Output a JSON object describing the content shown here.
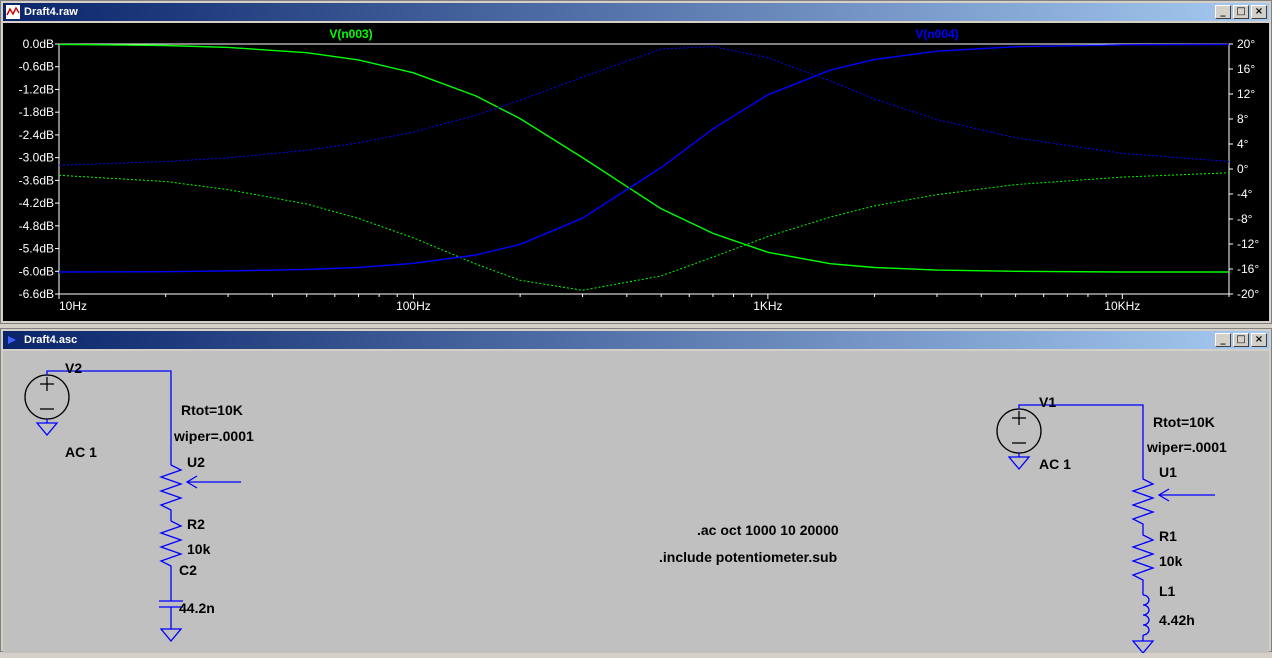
{
  "plot_window": {
    "title": "Draft4.raw",
    "buttons": [
      "_",
      "□",
      "×"
    ]
  },
  "schematic_window": {
    "title": "Draft4.asc",
    "buttons": [
      "_",
      "□",
      "×"
    ]
  },
  "colors": {
    "plot_background": "#000000",
    "trace_green": "#00ff00",
    "trace_blue": "#0000ff",
    "axis_text": "#ffffff",
    "schematic_wire": "#0000ff",
    "schematic_background": "#c0c0c0"
  },
  "chart_data": {
    "type": "line",
    "xscale": "log",
    "xlim": [
      10,
      20000
    ],
    "x_ticks": [
      {
        "value": 10,
        "label": "10Hz"
      },
      {
        "value": 100,
        "label": "100Hz"
      },
      {
        "value": 1000,
        "label": "1KHz"
      },
      {
        "value": 10000,
        "label": "10KHz"
      }
    ],
    "ylim_left": [
      -6.6,
      0
    ],
    "y_ticks_left": [
      "0.0dB",
      "-0.6dB",
      "-1.2dB",
      "-1.8dB",
      "-2.4dB",
      "-3.0dB",
      "-3.6dB",
      "-4.2dB",
      "-4.8dB",
      "-5.4dB",
      "-6.0dB",
      "-6.6dB"
    ],
    "ylim_right": [
      -20,
      20
    ],
    "y_ticks_right": [
      "20°",
      "16°",
      "12°",
      "8°",
      "4°",
      "0°",
      "-4°",
      "-8°",
      "-12°",
      "-16°",
      "-20°"
    ],
    "series": [
      {
        "name": "V(n003)",
        "color": "#00ff00",
        "magnitude": {
          "x": [
            10,
            20,
            30,
            50,
            70,
            100,
            150,
            200,
            300,
            500,
            700,
            1000,
            1500,
            2000,
            3000,
            5000,
            10000,
            20000
          ],
          "y": [
            -0.01,
            -0.04,
            -0.09,
            -0.23,
            -0.42,
            -0.76,
            -1.37,
            -1.97,
            -3.0,
            -4.35,
            -5.0,
            -5.5,
            -5.8,
            -5.9,
            -5.97,
            -6.0,
            -6.02,
            -6.02
          ]
        },
        "phase": {
          "x": [
            10,
            20,
            30,
            50,
            70,
            100,
            150,
            200,
            300,
            500,
            700,
            1000,
            1500,
            2000,
            3000,
            5000,
            10000,
            20000
          ],
          "y": [
            -1.0,
            -2.0,
            -3.3,
            -5.6,
            -7.9,
            -11.0,
            -15.2,
            -17.8,
            -19.4,
            -17.1,
            -14.1,
            -10.8,
            -7.7,
            -5.9,
            -4.1,
            -2.5,
            -1.3,
            -0.6
          ]
        }
      },
      {
        "name": "V(n004)",
        "color": "#0000ff",
        "magnitude": {
          "x": [
            10,
            20,
            30,
            50,
            70,
            100,
            150,
            200,
            300,
            500,
            700,
            1000,
            1500,
            2000,
            3000,
            5000,
            10000,
            20000
          ],
          "y": [
            -6.02,
            -6.01,
            -5.99,
            -5.95,
            -5.9,
            -5.79,
            -5.57,
            -5.29,
            -4.6,
            -3.26,
            -2.24,
            -1.34,
            -0.69,
            -0.41,
            -0.19,
            -0.07,
            -0.02,
            -0.01
          ]
        },
        "phase": {
          "x": [
            10,
            20,
            30,
            50,
            70,
            100,
            150,
            200,
            300,
            500,
            700,
            1000,
            1500,
            2000,
            3000,
            5000,
            10000,
            20000
          ],
          "y": [
            0.6,
            1.2,
            1.8,
            3.0,
            4.2,
            5.9,
            8.6,
            11.0,
            14.7,
            19.2,
            19.6,
            17.8,
            14.1,
            11.2,
            7.9,
            5.0,
            2.5,
            1.2
          ]
        }
      }
    ]
  },
  "schematic": {
    "left_circuit": {
      "source_name": "V2",
      "source_value": "AC 1",
      "pot_params_1": "Rtot=10K",
      "pot_params_2": "wiper=.0001",
      "pot_name": "U2",
      "resistor_name": "R2",
      "resistor_value": "10k",
      "cap_name": "C2",
      "cap_value": "44.2n"
    },
    "right_circuit": {
      "source_name": "V1",
      "source_value": "AC 1",
      "pot_params_1": "Rtot=10K",
      "pot_params_2": "wiper=.0001",
      "pot_name": "U1",
      "resistor_name": "R1",
      "resistor_value": "10k",
      "inductor_name": "L1",
      "inductor_value": "4.42h"
    },
    "directives": [
      ".ac oct 1000 10 20000",
      ".include potentiometer.sub"
    ]
  }
}
